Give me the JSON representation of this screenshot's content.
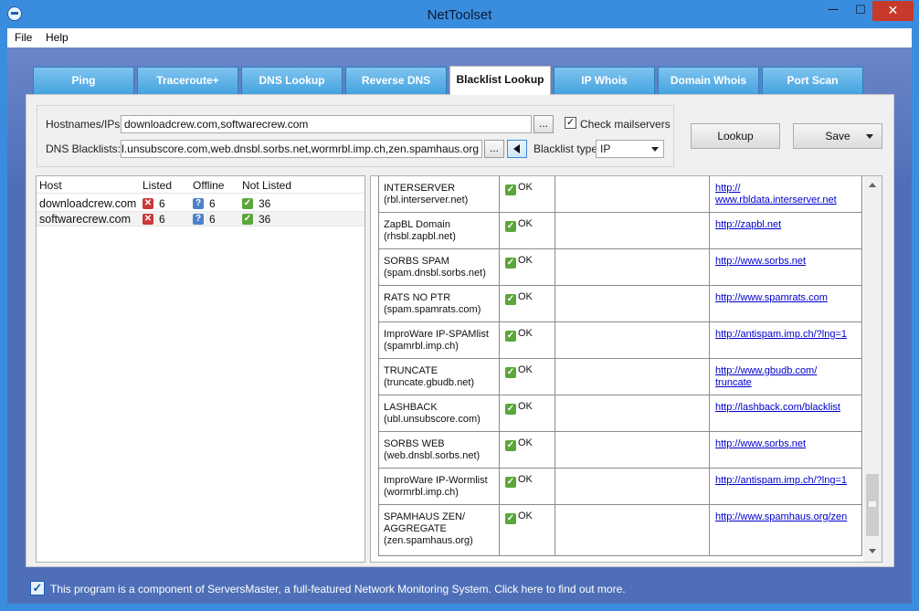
{
  "window": {
    "title": "NetToolset",
    "minimize_glyph": "─",
    "maximize_glyph": "☐",
    "close_glyph": "✕"
  },
  "menu": {
    "items": [
      "File",
      "Help"
    ]
  },
  "tabs": [
    {
      "label": "Ping",
      "active": false
    },
    {
      "label": "Traceroute+",
      "active": false
    },
    {
      "label": "DNS Lookup",
      "active": false
    },
    {
      "label": "Reverse DNS",
      "active": false
    },
    {
      "label": "Blacklist Lookup",
      "active": true
    },
    {
      "label": "IP Whois",
      "active": false
    },
    {
      "label": "Domain Whois",
      "active": false
    },
    {
      "label": "Port Scan",
      "active": false
    }
  ],
  "form": {
    "hostnames_label": "Hostnames/IPs:",
    "hostnames_value": "downloadcrew.com,softwarecrew.com",
    "browse_label": "...",
    "check_mailservers_label": "Check mailservers",
    "check_mailservers_checked": true,
    "check_glyph": "✓",
    "dns_blacklists_label": "DNS Blacklists:",
    "dns_blacklists_value": "net,ubl.unsubscore.com,web.dnsbl.sorbs.net,wormrbl.imp.ch,zen.spamhaus.org",
    "blacklist_type_label": "Blacklist type:",
    "blacklist_type_value": "IP"
  },
  "actions": {
    "lookup_label": "Lookup",
    "save_label": "Save"
  },
  "hosts": {
    "headers": {
      "host": "Host",
      "listed": "Listed",
      "offline": "Offline",
      "not_listed": "Not Listed"
    },
    "rows": [
      {
        "host": "downloadcrew.com",
        "listed": "6",
        "offline": "6",
        "not_listed": "36"
      },
      {
        "host": "softwarecrew.com",
        "listed": "6",
        "offline": "6",
        "not_listed": "36"
      }
    ],
    "icon_glyphs": {
      "listed": "✕",
      "offline": "?",
      "not_listed": "✓"
    }
  },
  "blacklist_results": [
    {
      "name": "INTERSERVER\n(rbl.interserver.net)",
      "status": "OK",
      "link": "http://\nwww.rbldata.interserver.net"
    },
    {
      "name": "ZapBL Domain\n(rhsbl.zapbl.net)",
      "status": "OK",
      "link": "http://zapbl.net"
    },
    {
      "name": "SORBS SPAM\n(spam.dnsbl.sorbs.net)",
      "status": "OK",
      "link": "http://www.sorbs.net"
    },
    {
      "name": "RATS NO PTR\n(spam.spamrats.com)",
      "status": "OK",
      "link": "http://www.spamrats.com"
    },
    {
      "name": "ImproWare IP-SPAMlist\n(spamrbl.imp.ch)",
      "status": "OK",
      "link": "http://antispam.imp.ch/?lng=1"
    },
    {
      "name": "TRUNCATE\n(truncate.gbudb.net)",
      "status": "OK",
      "link": "http://www.gbudb.com/\ntruncate"
    },
    {
      "name": "LASHBACK\n(ubl.unsubscore.com)",
      "status": "OK",
      "link": "http://lashback.com/blacklist"
    },
    {
      "name": "SORBS WEB\n(web.dnsbl.sorbs.net)",
      "status": "OK",
      "link": "http://www.sorbs.net"
    },
    {
      "name": "ImproWare IP-Wormlist\n(wormrbl.imp.ch)",
      "status": "OK",
      "link": "http://antispam.imp.ch/?lng=1"
    },
    {
      "name": "SPAMHAUS ZEN/\nAGGREGATE\n(zen.spamhaus.org)",
      "status": "OK",
      "link": "http://www.spamhaus.org/zen"
    }
  ],
  "footer": {
    "text": "This program is a component of ServersMaster, a full-featured Network Monitoring System. Click here to find out more.",
    "checked": true
  },
  "colors": {
    "title_bar": "#3a8dde",
    "tab_inactive": "#45a4e0",
    "close_button": "#c7392b",
    "link": "#0000cc"
  }
}
